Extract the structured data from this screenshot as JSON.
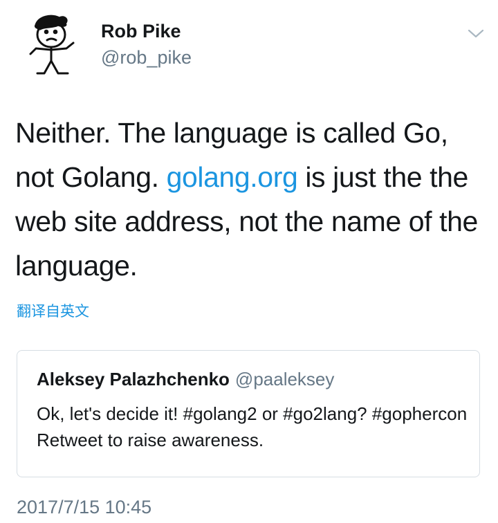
{
  "author": {
    "display_name": "Rob Pike",
    "handle": "@rob_pike",
    "avatar_icon": "stick-figure-avatar"
  },
  "menu": {
    "icon": "chevron-down-icon"
  },
  "tweet": {
    "text_before": "Neither. The language is called Go, not Golang. ",
    "link_text": "golang.org",
    "text_after": " is just the the web site address, not the name of the language."
  },
  "translate_label": "翻译自英文",
  "quoted_tweet": {
    "author_name": "Aleksey Palazhchenko",
    "author_handle": "@paaleksey",
    "text": "Ok, let's decide it! #golang2 or #go2lang? #gophercon Retweet to raise awareness."
  },
  "timestamp": "2017/7/15 10:45",
  "colors": {
    "link": "#1b95e0",
    "secondary_text": "#657786",
    "border": "#d6dde3"
  }
}
